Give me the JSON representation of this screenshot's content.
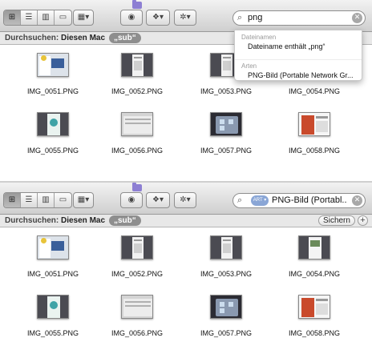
{
  "toolbar": {
    "view_icons": [
      "icon-view-icon",
      "list-view-icon",
      "column-view-icon",
      "coverflow-view-icon"
    ],
    "arrange_glyph": "▦▾",
    "quicklook_glyph": "◉",
    "dropbox_glyph": "❖▾",
    "action_glyph": "✲▾"
  },
  "scopebar": {
    "label": "Durchsuchen:",
    "this_mac": "Diesen Mac",
    "sub_folder": "„sub“",
    "save": "Sichern",
    "plus": "+"
  },
  "top_panel": {
    "search_query": "png",
    "dropdown": {
      "section1_header": "Dateinamen",
      "section1_item": "Dateiname enthält „png“",
      "section2_header": "Arten",
      "section2_item": "PNG-Bild (Portable Network Gr..."
    }
  },
  "bottom_panel": {
    "search_token": "ART ▾",
    "search_text": "PNG-Bild (Portabl..."
  },
  "files": [
    {
      "name": "IMG_0051.PNG",
      "style": "a"
    },
    {
      "name": "IMG_0052.PNG",
      "style": "b"
    },
    {
      "name": "IMG_0053.PNG",
      "style": "b"
    },
    {
      "name": "IMG_0054.PNG",
      "style": "c"
    },
    {
      "name": "IMG_0055.PNG",
      "style": "d"
    },
    {
      "name": "IMG_0056.PNG",
      "style": "e"
    },
    {
      "name": "IMG_0057.PNG",
      "style": "f"
    },
    {
      "name": "IMG_0058.PNG",
      "style": "g"
    }
  ]
}
